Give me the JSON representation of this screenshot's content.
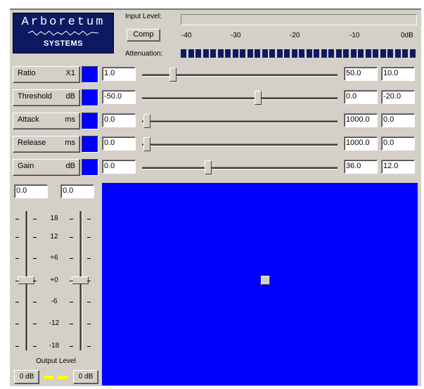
{
  "logo": {
    "line1": "Arboretum",
    "line2": "SYSTEMS"
  },
  "input_level": {
    "label": "Input Level:"
  },
  "comp_button": {
    "label": "Comp"
  },
  "scale": [
    "-40",
    "-30",
    "-20",
    "-10",
    "0dB"
  ],
  "attenuation": {
    "label": "Attenuation:",
    "segments": 32
  },
  "params": [
    {
      "label": "Ratio",
      "unit": "X1",
      "value": "1.0",
      "max": "50.0",
      "current": "10.0",
      "slider_pos": 0.14
    },
    {
      "label": "Threshold",
      "unit": "dB",
      "value": "-50.0",
      "max": "0.0",
      "current": "-20.0",
      "slider_pos": 0.6
    },
    {
      "label": "Attack",
      "unit": "ms",
      "value": "0.0",
      "max": "1000.0",
      "current": "0.0",
      "slider_pos": 0.0
    },
    {
      "label": "Release",
      "unit": "ms",
      "value": "0.0",
      "max": "1000.0",
      "current": "0.0",
      "slider_pos": 0.0
    },
    {
      "label": "Gain",
      "unit": "dB",
      "value": "0.0",
      "max": "36.0",
      "current": "12.0",
      "slider_pos": 0.33
    }
  ],
  "output": {
    "left_value": "0.0",
    "right_value": "0.0",
    "db_scale": [
      "18",
      "12",
      "+6",
      "+0",
      "-6",
      "-12",
      "-18"
    ],
    "label": "Output Level",
    "left_db": "0 dB",
    "right_db": "0 dB"
  },
  "colors": {
    "display_bg": "#0000ff",
    "swatch": "#0000ff",
    "meter_segment": "#0c1a63",
    "led": "#ffff00"
  }
}
